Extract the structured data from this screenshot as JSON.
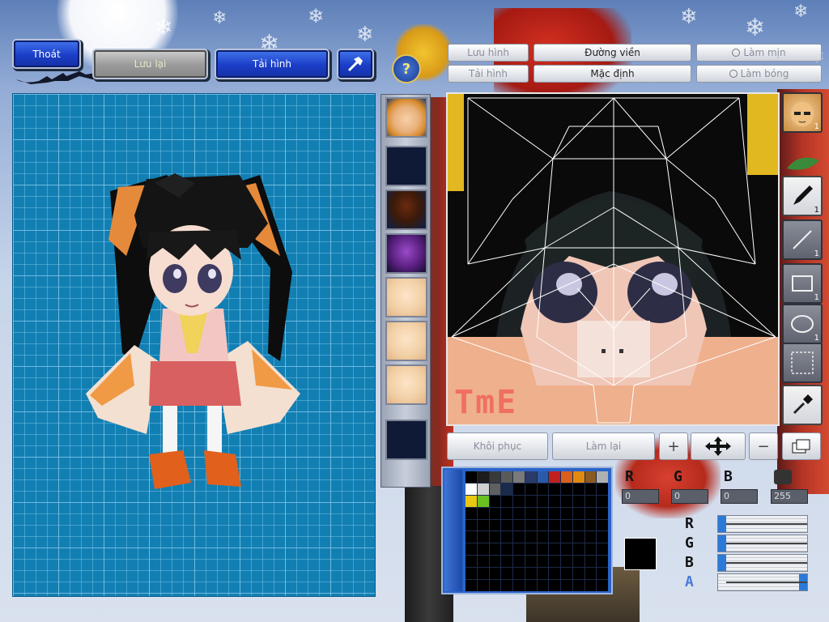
{
  "top_buttons": {
    "exit": "Thoát",
    "save": "Lưu lại",
    "load": "Tải hình",
    "tool_icon": "hammer-icon"
  },
  "editor_buttons": {
    "help_icon": "question-icon",
    "save_image": "Lưu hình",
    "load_image": "Tải hình",
    "outline": "Đường viền",
    "default": "Mặc định",
    "smooth": "Làm mịn",
    "shine": "Làm bóng"
  },
  "bottom_buttons": {
    "restore": "Khôi phục",
    "redo": "Làm lại",
    "plus_icon": "plus-icon",
    "move_icon": "move-arrows-icon",
    "minus_icon": "minus-icon",
    "layers_icon": "layers-icon"
  },
  "tools": [
    {
      "name": "face-preview",
      "num": "1"
    },
    {
      "name": "pen-tool",
      "num": "1"
    },
    {
      "name": "line-tool",
      "num": "1"
    },
    {
      "name": "rectangle-tool",
      "num": "1"
    },
    {
      "name": "ellipse-tool",
      "num": "1"
    },
    {
      "name": "select-tool",
      "num": ""
    },
    {
      "name": "eyedropper-tool",
      "num": ""
    }
  ],
  "watermark": "TmE",
  "palette": {
    "row1": [
      "#000000",
      "#1c1c1c",
      "#3a3a3a",
      "#5a5a5a",
      "#7a7a7a",
      "#2a3a6a",
      "#2a5aa8",
      "#c02020",
      "#d8601c",
      "#e08a10",
      "#8a5a20",
      "#b0b0b0"
    ],
    "row2": [
      "#ffffff",
      "#d0d0d0",
      "#606060",
      "#1a2a4a",
      "#000000",
      "#000000",
      "#000000",
      "#000000",
      "#000000",
      "#000000",
      "#000000",
      "#000000"
    ],
    "row3": [
      "#e8c810",
      "#6ac020",
      "#000000",
      "#000000",
      "#000000",
      "#000000",
      "#000000",
      "#000000",
      "#000000",
      "#000000",
      "#000000",
      "#000000"
    ],
    "current_color": "#000000"
  },
  "rgb": {
    "r_label": "R",
    "g_label": "G",
    "b_label": "B",
    "a_label": "A",
    "r": "0",
    "g": "0",
    "b": "0",
    "a": "255"
  },
  "sliders": {
    "r": 0,
    "g": 0,
    "b": 0,
    "a": 1
  }
}
